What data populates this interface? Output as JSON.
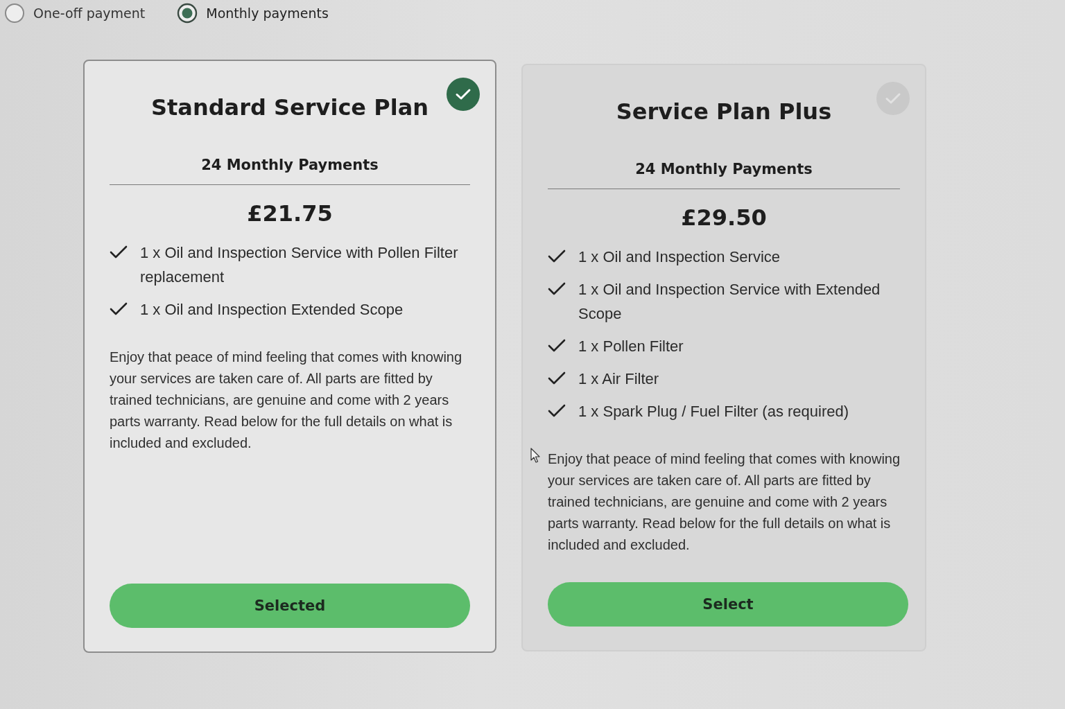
{
  "payment_options": [
    {
      "label": "One-off payment",
      "selected": false
    },
    {
      "label": "Monthly payments",
      "selected": true
    }
  ],
  "plans": [
    {
      "title": "Standard Service Plan",
      "selected": true,
      "term": "24 Monthly Payments",
      "price": "£21.75",
      "features": [
        "1 x Oil and Inspection Service with Pollen Filter replacement",
        "1 x Oil and Inspection Extended Scope"
      ],
      "description": "Enjoy that peace of mind feeling that comes with knowing your services are taken care of. All parts are fitted by trained technicians, are genuine and come with 2 years parts warranty. Read below for the full details on what is included and excluded.",
      "button": "Selected"
    },
    {
      "title": "Service Plan Plus",
      "selected": false,
      "term": "24 Monthly Payments",
      "price": "£29.50",
      "features": [
        "1 x Oil and Inspection Service",
        "1 x Oil and Inspection Service with Extended Scope",
        "1 x Pollen Filter",
        "1 x Air Filter",
        "1 x Spark Plug / Fuel Filter (as required)"
      ],
      "description": "Enjoy that peace of mind feeling that comes with knowing your services are taken care of. All parts are fitted by trained technicians, are genuine and come with 2 years parts warranty. Read below for the full details on what is included and excluded.",
      "button": "Select"
    }
  ]
}
